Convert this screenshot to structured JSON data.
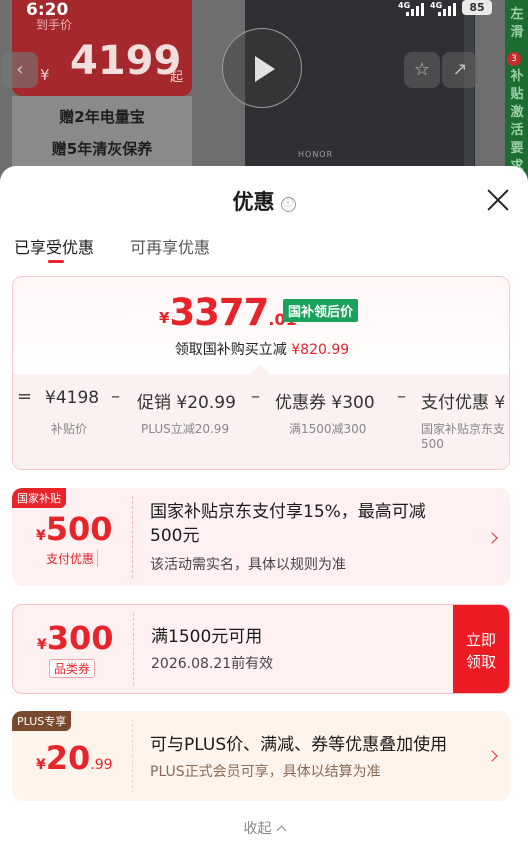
{
  "status_bar": {
    "time": "6:20",
    "net1": "4G",
    "net2": "4G",
    "battery": "85"
  },
  "background": {
    "arrive_label": "到手价",
    "currency": "¥",
    "price": "4199",
    "price_suffix": "起",
    "gift1": "赠2年电量宝",
    "gift2": "赠5年清灰保养",
    "brand": "HONOR",
    "side_badge": "3",
    "side_text_top": "左滑",
    "side_text_bottom": "补贴激活要求"
  },
  "sheet": {
    "title": "优惠",
    "info_icon": "ⓘ",
    "tabs": [
      {
        "label": "已享受优惠"
      },
      {
        "label": "可再享优惠"
      }
    ]
  },
  "summary": {
    "currency": "¥",
    "price_int": "3377",
    "price_dec": ".01",
    "tag": "国补领后价",
    "desc_prefix": "领取国补购买立减",
    "desc_amount": "¥820.99",
    "formula": {
      "op_eq": "=",
      "op_minus": "–",
      "items": [
        {
          "label": "¥4198",
          "sub": "补贴价"
        },
        {
          "label": "促销 ¥20.99",
          "sub": "PLUS立减20.99"
        },
        {
          "label": "优惠券 ¥300",
          "sub": "满1500减300"
        },
        {
          "label": "支付优惠 ¥",
          "sub": "国家补贴京东支",
          "sub2": "500"
        }
      ]
    }
  },
  "cards": [
    {
      "tag": "国家补贴",
      "currency": "¥",
      "amount": "500",
      "amount_sub": "支付优惠",
      "title_line1": "国家补贴京东支付享15%，最高可减",
      "title_line2": "500元",
      "desc": "该活动需实名，具体以规则为准"
    },
    {
      "currency": "¥",
      "amount": "300",
      "amount_sub": "品类券",
      "title": "满1500元可用",
      "desc": "2026.08.21前有效",
      "claim_line1": "立即",
      "claim_line2": "领取"
    },
    {
      "tag": "PLUS专享",
      "currency": "¥",
      "amount": "20",
      "amount_dec": ".99",
      "title": "可与PLUS价、满减、券等优惠叠加使用",
      "desc": "PLUS正式会员可享，具体以结算为准"
    }
  ],
  "collapse_label": "收起",
  "colors": {
    "accent": "#e8242b",
    "green_tag": "#1aa25b",
    "plus_brown": "#7a4a2e"
  }
}
